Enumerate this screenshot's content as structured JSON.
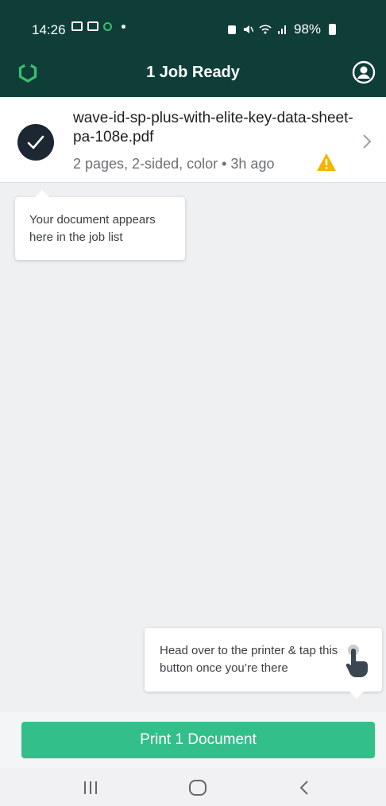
{
  "status_bar": {
    "time": "14:26",
    "battery": "98%"
  },
  "app_bar": {
    "title": "1 Job Ready",
    "logo_icon": "app-logo-icon",
    "profile_icon": "account-circle-icon"
  },
  "job": {
    "name": "wave-id-sp-plus-with-elite-key-data-sheet-pa-108e.pdf",
    "meta": "2 pages, 2-sided, color • 3h ago",
    "status_icon": "check-icon",
    "warning_icon": "warning-icon"
  },
  "tooltips": {
    "job_list": "Your document appears here in the job list",
    "printer": "Head over to the printer & tap this button once you’re there"
  },
  "print_button": {
    "label": "Print 1 Document"
  },
  "colors": {
    "app_bar": "#0f3d38",
    "accent_green": "#33bf8a",
    "check_circle": "#1d2733",
    "warning": "#f5b400"
  }
}
